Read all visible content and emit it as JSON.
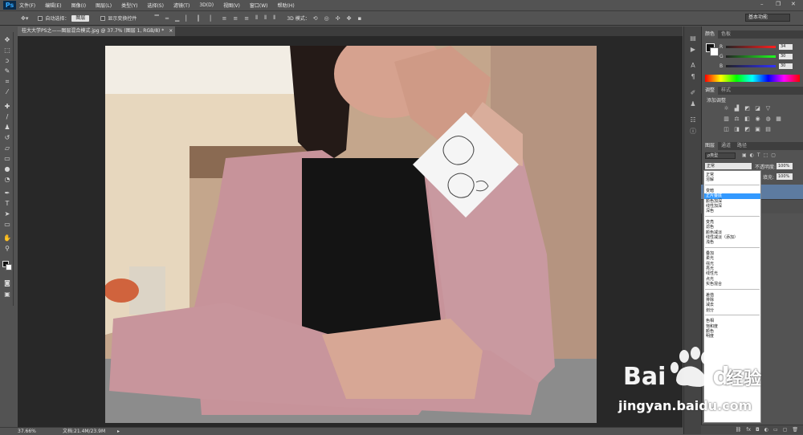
{
  "app": {
    "logo": "Ps"
  },
  "menubar": [
    "文件(F)",
    "编辑(E)",
    "图像(I)",
    "图层(L)",
    "类型(Y)",
    "选择(S)",
    "滤镜(T)",
    "3D(D)",
    "视图(V)",
    "窗口(W)",
    "帮助(H)"
  ],
  "window_controls": {
    "minimize": "–",
    "restore": "❐",
    "close": "✕"
  },
  "options": {
    "auto_select_label": "自动选择：",
    "auto_select_value": "图层",
    "show_transform_label": "显示变换控件",
    "mode_3d_label": "3D 模式："
  },
  "workspace": "基本功能",
  "document": {
    "tab_title": "桂大大学PS之——图层混合模式.jpg @ 37.7% (图层 1, RGB/8) *",
    "tab_close": "×"
  },
  "status": {
    "zoom": "37.66%",
    "doc_size": "文档:21.4M/23.9M"
  },
  "color_panel": {
    "tabs": [
      "颜色",
      "色板"
    ],
    "channels": [
      {
        "label": "R",
        "value": "34"
      },
      {
        "label": "G",
        "value": "30"
      },
      {
        "label": "B",
        "value": "30"
      }
    ]
  },
  "adjust_panel": {
    "tabs": [
      "调整",
      "样式"
    ],
    "title": "添加调整"
  },
  "layers_panel": {
    "tabs": [
      "图层",
      "通道",
      "路径"
    ],
    "filter_label": "ρ类型",
    "blend_mode": "正常",
    "opacity_label": "不透明度:",
    "opacity_value": "100%",
    "fill_label": "填充:",
    "fill_value": "100%"
  },
  "blend_menu": {
    "highlighted": "正片叠底",
    "groups": [
      [
        "正常",
        "溶解"
      ],
      [
        "变暗",
        "正片叠底",
        "颜色加深",
        "线性加深",
        "深色"
      ],
      [
        "变亮",
        "滤色",
        "颜色减淡",
        "线性减淡（添加）",
        "浅色"
      ],
      [
        "叠加",
        "柔光",
        "强光",
        "亮光",
        "线性光",
        "点光",
        "实色混合"
      ],
      [
        "差值",
        "排除",
        "减去",
        "划分"
      ],
      [
        "色相",
        "饱和度",
        "颜色",
        "明度"
      ]
    ]
  },
  "watermark": {
    "brand": "Bai",
    "brand2": "du",
    "suffix": "经验",
    "url": "jingyan.baidu.com"
  },
  "colors": {
    "accent": "#3399ff",
    "layer_selected": "#5d7ba0",
    "ps_blue": "#31a8ff"
  }
}
